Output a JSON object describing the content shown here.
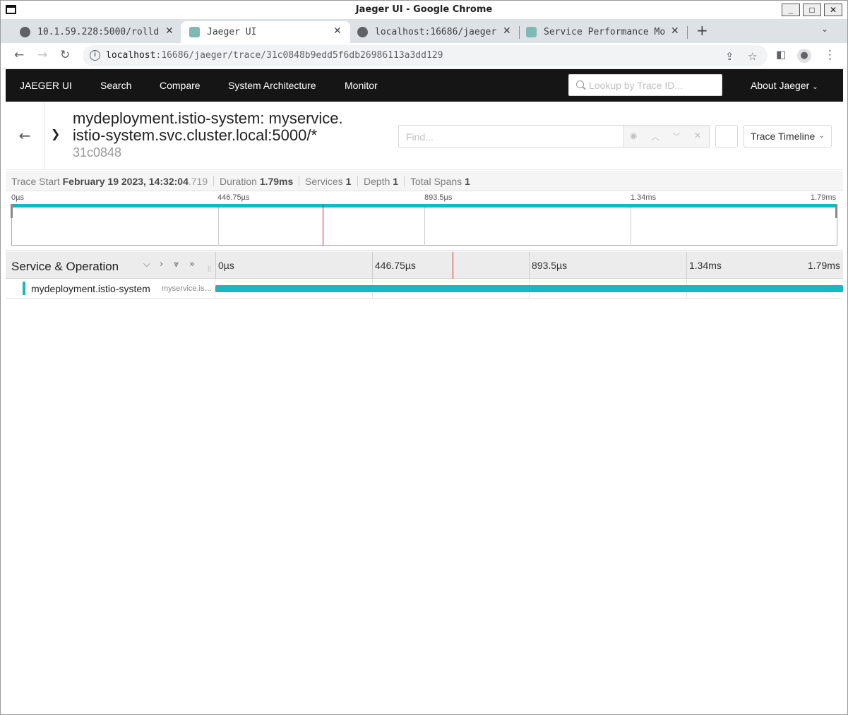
{
  "window": {
    "title": "Jaeger UI - Google Chrome"
  },
  "tabs": [
    {
      "label": "10.1.59.228:5000/rolld",
      "active": false
    },
    {
      "label": "Jaeger UI",
      "active": true
    },
    {
      "label": "localhost:16686/jaeger",
      "active": false
    },
    {
      "label": "Service Performance Mo",
      "active": false
    }
  ],
  "address": {
    "host": "localhost",
    "path": ":16686/jaeger/trace/31c0848b9edd5f6db26986113a3dd129"
  },
  "jaeger_nav": {
    "brand": "JAEGER UI",
    "links": [
      "Search",
      "Compare",
      "System Architecture",
      "Monitor"
    ],
    "lookup_placeholder": "Lookup by Trace ID...",
    "about": "About Jaeger"
  },
  "trace": {
    "title": "mydeployment.istio-system: myservice.istio-system.svc.cluster.local:5000/*",
    "title_line1": "mydeployment.istio-system: myservice.",
    "title_line2": "istio-system.svc.cluster.local:5000/*",
    "short_id": "31c0848",
    "find_placeholder": "Find...",
    "kb_icon": "",
    "view_mode": "Trace Timeline"
  },
  "meta": {
    "start_label": "Trace Start",
    "start_date": "February 19 2023, 14:32:04",
    "start_ms": ".719",
    "duration_label": "Duration",
    "duration": "1.79ms",
    "services_label": "Services",
    "services": "1",
    "depth_label": "Depth",
    "depth": "1",
    "spans_label": "Total Spans",
    "spans": "1"
  },
  "minimap": {
    "ticks": [
      "0µs",
      "446.75µs",
      "893.5µs",
      "1.34ms",
      "1.79ms"
    ]
  },
  "timeline": {
    "header": "Service & Operation",
    "ticks": [
      "0µs",
      "446.75µs",
      "893.5µs",
      "1.34ms",
      "1.79ms"
    ],
    "spans": [
      {
        "service": "mydeployment.istio-system",
        "operation": "myservice.istio-system.svc.cluster.local:5000/*",
        "color": "#17b8be"
      }
    ]
  },
  "colors": {
    "accent": "#17b8be",
    "cursor": "#d62728",
    "nav_bg": "#151515"
  }
}
